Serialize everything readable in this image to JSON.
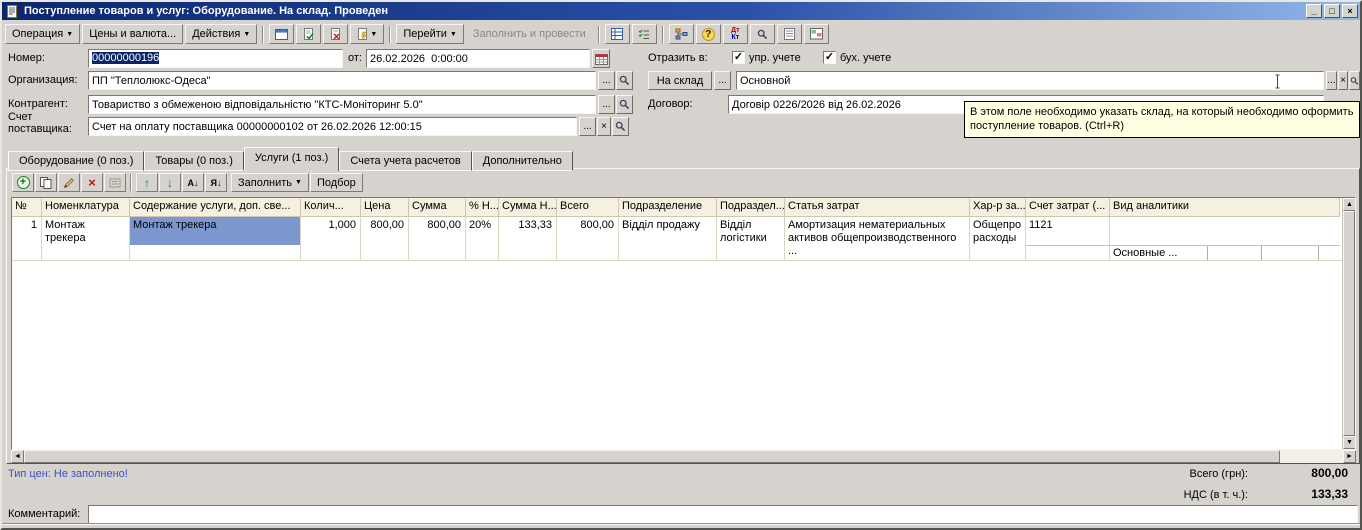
{
  "icons": {
    "dropdown": "▼",
    "minimize": "_",
    "maximize": "□",
    "close": "×",
    "ellipsis": "...",
    "clear": "×",
    "check": "✓",
    "add": "+",
    "delete": "×",
    "move_up": "↑",
    "move_down": "↓",
    "sort_asc": "А↓",
    "sort_desc": "Я↓",
    "help": "?",
    "scroll_left": "◄",
    "scroll_right": "►",
    "scroll_up": "▲",
    "scroll_down": "▼"
  },
  "window": {
    "title": "Поступление товаров и услуг: Оборудование. На склад. Проведен"
  },
  "toolbar": {
    "operation": "Операция",
    "prices": "Цены и валюта...",
    "actions": "Действия",
    "goto": "Перейти",
    "fill_post": "Заполнить и провести",
    "dt": "Дт",
    "kt": "Кт"
  },
  "form": {
    "number_label": "Номер:",
    "number_value": "00000000196",
    "date_label": "от:",
    "date_value": "26.02.2026  0:00:00",
    "org_label": "Организация:",
    "org_value": "ПП \"Теплолюкс-Одеса\"",
    "contractor_label": "Контрагент:",
    "contractor_value": "Товариство з обмеженою відповідальністю \"КТС-Моніторинг 5.0\"",
    "invoice_label1": "Счет",
    "invoice_label2": "поставщика:",
    "invoice_value": "Счет на оплату поставщика 00000000102 от 26.02.2026 12:00:15",
    "reflect_label": "Отразить в:",
    "reflect_upr": "упр. учете",
    "reflect_buh": "бух. учете",
    "warehouse_button": "На склад",
    "warehouse_value": "Основной",
    "contract_label": "Договор:",
    "contract_value": "Договір 0226/2026 від 26.02.2026",
    "tooltip1": "В этом поле необходимо указать склад, на который необходимо оформить",
    "tooltip2": "поступление товаров. (Ctrl+R)"
  },
  "tabs": [
    {
      "label": "Оборудование (0 поз.)"
    },
    {
      "label": "Товары (0 поз.)"
    },
    {
      "label": "Услуги (1 поз.)"
    },
    {
      "label": "Счета учета расчетов"
    },
    {
      "label": "Дополнительно"
    }
  ],
  "grid_toolbar": {
    "fill": "Заполнить",
    "pick": "Подбор"
  },
  "grid": {
    "columns": [
      "№",
      "Номенклатура",
      "Содержание услуги, доп. све...",
      "Колич...",
      "Цена",
      "Сумма",
      "% Н...",
      "Сумма Н...",
      "Всего",
      "Подразделение",
      "Подраздел...",
      "Статья затрат",
      "Хар-р за...",
      "Счет затрат (...",
      "Вид аналитики"
    ],
    "row": {
      "num": "1",
      "nomenclature": "Монтаж трекера",
      "content": "Монтаж трекера",
      "qty": "1,000",
      "price": "800,00",
      "sum": "800,00",
      "vat_rate": "20%",
      "vat_sum": "133,33",
      "total": "800,00",
      "department": "Відділ продажу",
      "subdepartment": "Відділ логістики",
      "cost_item": "Амортизация нематериальных активов общепроизводственного ...",
      "cost_kind": "Общепро расходы",
      "cost_account": "1121",
      "analytics": "Основные ..."
    }
  },
  "footer": {
    "price_type": "Тип цен: Не заполнено!",
    "total_label": "Всего (грн):",
    "total_value": "800,00",
    "vat_label": "НДС (в т. ч.):",
    "vat_value": "133,33",
    "comment_label": "Комментарий:",
    "comment_value": ""
  }
}
